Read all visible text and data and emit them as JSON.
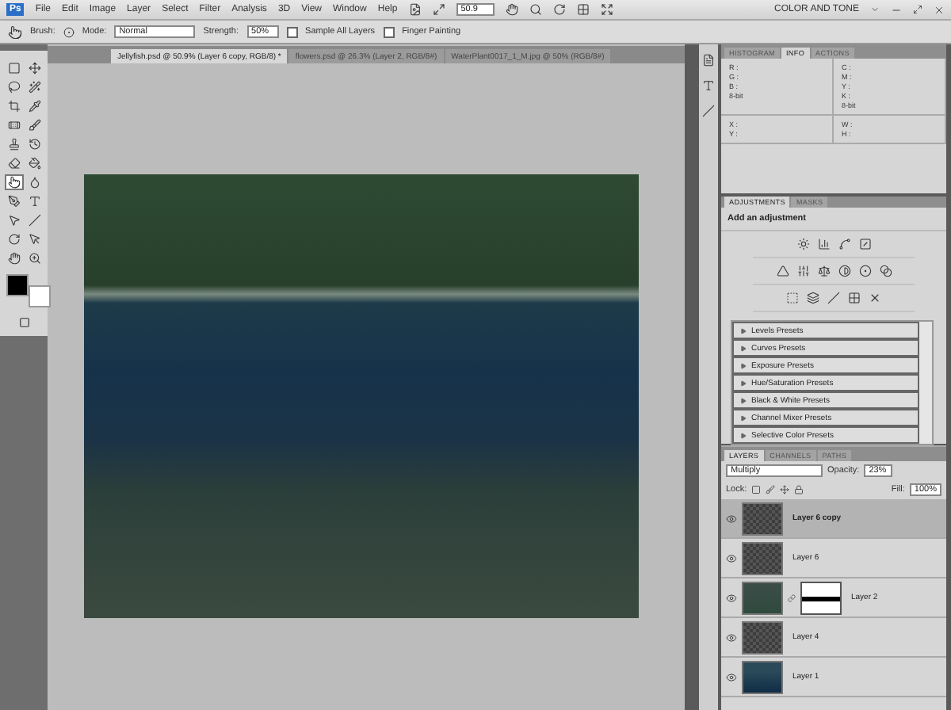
{
  "app_bar": {
    "logo": "Ps",
    "menus": [
      "File",
      "Edit",
      "Image",
      "Layer",
      "Select",
      "Filter",
      "Analysis",
      "3D",
      "View",
      "Window",
      "Help"
    ],
    "zoom": "50.9",
    "workspace": "COLOR AND TONE"
  },
  "options_bar": {
    "brush_label": "Brush:",
    "mode_label": "Mode:",
    "mode": "Normal",
    "strength_label": "Strength:",
    "strength": "50%",
    "checkboxes": [
      {
        "label": "Sample All Layers",
        "checked": false
      },
      {
        "label": "Finger Painting",
        "checked": false
      }
    ]
  },
  "document_tabs": [
    {
      "label": "Jellyfish.psd @ 50.9% (Layer 6 copy, RGB/8) *",
      "selected": true
    },
    {
      "label": "flowers.psd @ 26.3% (Layer 2, RGB/8#)",
      "selected": false
    },
    {
      "label": "WaterPlant0017_1_M.jpg @ 50% (RGB/8#)",
      "selected": false
    }
  ],
  "tools": [
    {
      "selected": false
    },
    {
      "selected": false
    },
    {
      "selected": false
    },
    {
      "selected": false
    },
    {
      "selected": false
    },
    {
      "selected": false
    },
    {
      "selected": false
    },
    {
      "selected": false
    },
    {
      "selected": false
    },
    {
      "selected": false
    },
    {
      "selected": false
    },
    {
      "selected": false
    },
    {
      "selected": true
    },
    {
      "selected": false
    },
    {
      "selected": false
    },
    {
      "selected": false
    },
    {
      "selected": false
    },
    {
      "selected": false
    },
    {
      "selected": false
    },
    {
      "selected": false
    },
    {
      "selected": false
    },
    {
      "selected": false
    }
  ],
  "info_panel": {
    "tabs": [
      {
        "label": "HISTOGRAM",
        "selected": false
      },
      {
        "label": "INFO",
        "selected": true
      },
      {
        "label": "ACTIONS",
        "selected": false
      }
    ],
    "left_labels": [
      "R :",
      "G :",
      "B :"
    ],
    "right_labels": [
      "C :",
      "M :",
      "Y :",
      "K :"
    ],
    "bit_depths": [
      "8-bit",
      "8-bit"
    ],
    "position_labels": [
      "X :",
      "Y :"
    ],
    "size_labels": [
      "W :",
      "H :"
    ]
  },
  "adjustments_panel": {
    "tabs": [
      {
        "label": "ADJUSTMENTS",
        "selected": true
      },
      {
        "label": "MASKS",
        "selected": false
      }
    ],
    "heading": "Add an adjustment",
    "presets": [
      "Levels Presets",
      "Curves Presets",
      "Exposure Presets",
      "Hue/Saturation Presets",
      "Black & White Presets",
      "Channel Mixer Presets",
      "Selective Color Presets"
    ]
  },
  "layers_panel": {
    "tabs": [
      {
        "label": "LAYERS",
        "selected": true
      },
      {
        "label": "CHANNELS",
        "selected": false
      },
      {
        "label": "PATHS",
        "selected": false
      }
    ],
    "blend_mode": "Multiply",
    "opacity_label": "Opacity:",
    "opacity": "23%",
    "lock_label": "Lock:",
    "fill_label": "Fill:",
    "fill": "100%",
    "layers": [
      {
        "name": "Layer 6 copy",
        "selected": true,
        "has_mask": false,
        "kind": "transparent"
      },
      {
        "name": "Layer 6",
        "selected": false,
        "has_mask": false,
        "kind": "transparent"
      },
      {
        "name": "Layer 2",
        "selected": false,
        "has_mask": true,
        "kind": "seabed"
      },
      {
        "name": "Layer 4",
        "selected": false,
        "has_mask": false,
        "kind": "transparent"
      },
      {
        "name": "Layer 1",
        "selected": false,
        "has_mask": false,
        "kind": "water"
      }
    ]
  }
}
